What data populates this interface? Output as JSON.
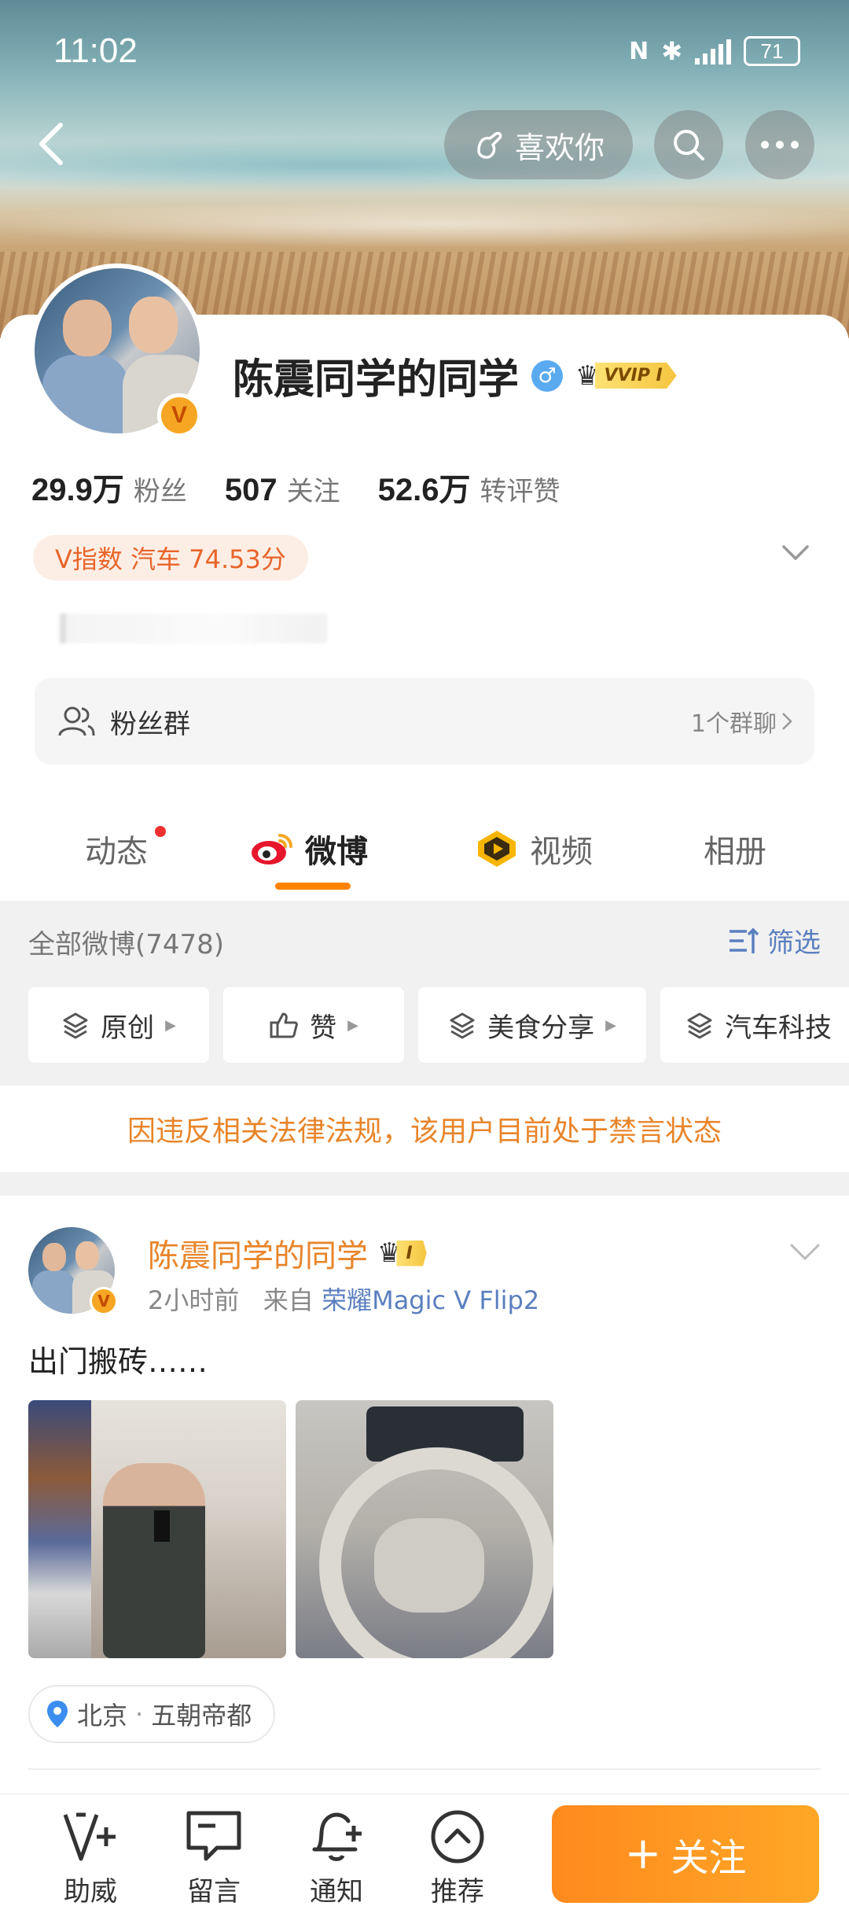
{
  "status_bar": {
    "time": "11:02",
    "battery": "71"
  },
  "nav": {
    "like_label": "喜欢你"
  },
  "profile": {
    "name": "陈震同学的同学",
    "vip_level": "VVIP I",
    "stats": [
      {
        "num": "29.9万",
        "label": "粉丝"
      },
      {
        "num": "507",
        "label": "关注"
      },
      {
        "num": "52.6万",
        "label": "转评赞"
      }
    ],
    "v_index": "V指数 汽车 74.53分",
    "fans_group": {
      "label": "粉丝群",
      "count": "1个群聊"
    }
  },
  "tabs": [
    {
      "label": "动态"
    },
    {
      "label": "微博"
    },
    {
      "label": "视频"
    },
    {
      "label": "相册"
    }
  ],
  "filter": {
    "all_label": "全部微博(7478)",
    "filter_label": "筛选",
    "chips": [
      "原创",
      "赞",
      "美食分享",
      "汽车科技"
    ]
  },
  "ban_notice": "因违反相关法律法规，该用户目前处于禁言状态",
  "post": {
    "author": "陈震同学的同学",
    "vip_level": "I",
    "time": "2小时前",
    "from": "来自",
    "device": "荣耀Magic V Flip2",
    "text": "出门搬砖……",
    "location_city": "北京",
    "location_sep": "·",
    "location_place": "五朝帝都"
  },
  "bottom_bar": {
    "items": [
      "助威",
      "留言",
      "通知",
      "推荐"
    ],
    "follow_label": "关注"
  },
  "colors": {
    "accent": "#ff8200",
    "link": "#5a7fbf",
    "orange_text": "#e8852a"
  }
}
